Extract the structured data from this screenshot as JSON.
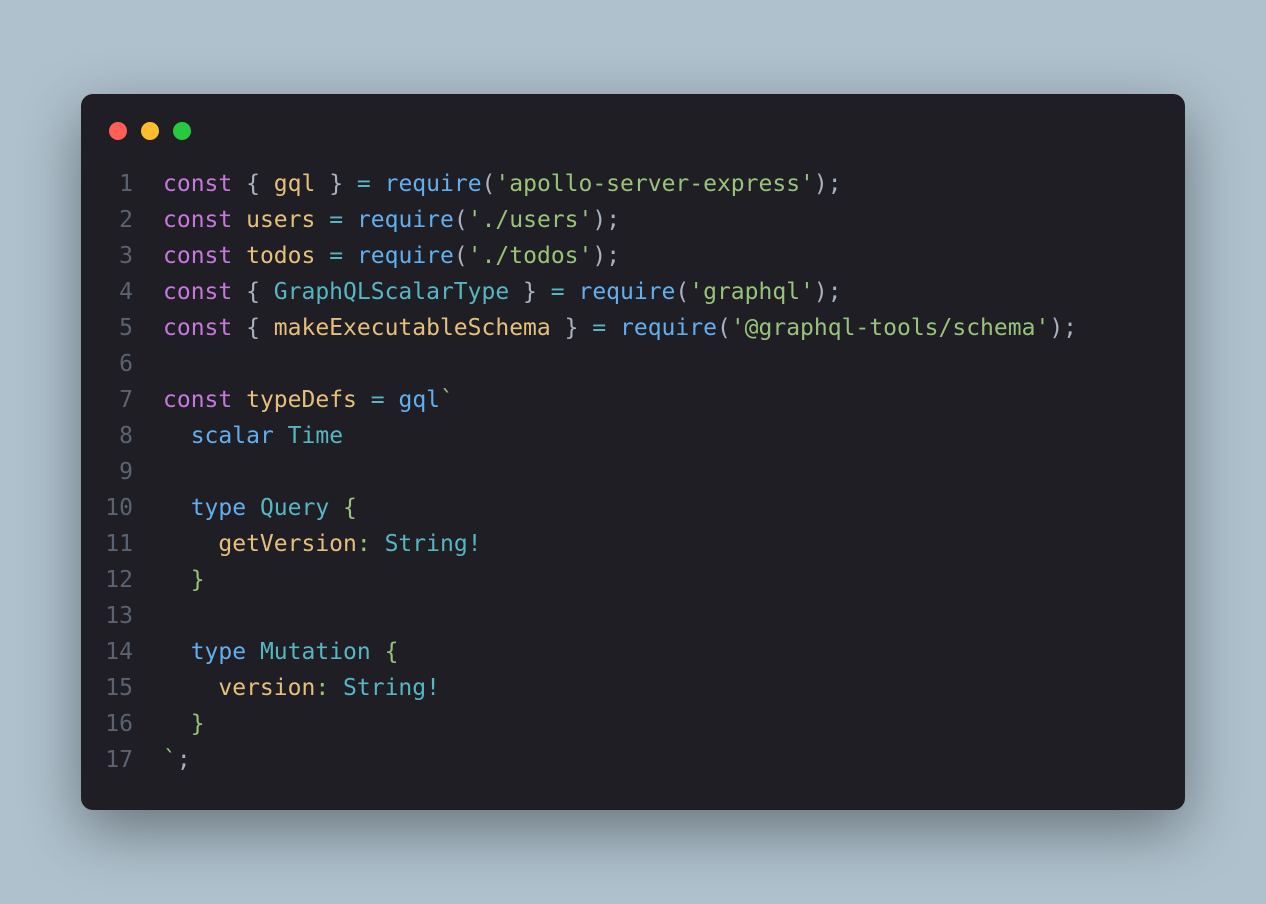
{
  "colors": {
    "bg": "#afc1cd",
    "window": "#1f1e25",
    "red": "#ff5f56",
    "yellow": "#ffbd2e",
    "green": "#27c93f",
    "keyword": "#c678dd",
    "definition": "#e5c07b",
    "function": "#61afef",
    "string": "#98c379",
    "identifier": "#56b6c2",
    "punct": "#abb2bf",
    "gutter": "#5c6370"
  },
  "lines": [
    {
      "n": "1",
      "t": [
        [
          "kw",
          "const"
        ],
        [
          "punct",
          " { "
        ],
        [
          "def",
          "gql"
        ],
        [
          "punct",
          " } "
        ],
        [
          "op",
          "="
        ],
        [
          "punct",
          " "
        ],
        [
          "fn",
          "require"
        ],
        [
          "punct",
          "("
        ],
        [
          "str",
          "'apollo-server-express'"
        ],
        [
          "punct",
          ");"
        ]
      ]
    },
    {
      "n": "2",
      "t": [
        [
          "kw",
          "const"
        ],
        [
          "punct",
          " "
        ],
        [
          "def",
          "users"
        ],
        [
          "punct",
          " "
        ],
        [
          "op",
          "="
        ],
        [
          "punct",
          " "
        ],
        [
          "fn",
          "require"
        ],
        [
          "punct",
          "("
        ],
        [
          "str",
          "'./users'"
        ],
        [
          "punct",
          ");"
        ]
      ]
    },
    {
      "n": "3",
      "t": [
        [
          "kw",
          "const"
        ],
        [
          "punct",
          " "
        ],
        [
          "def",
          "todos"
        ],
        [
          "punct",
          " "
        ],
        [
          "op",
          "="
        ],
        [
          "punct",
          " "
        ],
        [
          "fn",
          "require"
        ],
        [
          "punct",
          "("
        ],
        [
          "str",
          "'./todos'"
        ],
        [
          "punct",
          ");"
        ]
      ]
    },
    {
      "n": "4",
      "t": [
        [
          "kw",
          "const"
        ],
        [
          "punct",
          " { "
        ],
        [
          "ident",
          "GraphQLScalarType"
        ],
        [
          "punct",
          " } "
        ],
        [
          "op",
          "="
        ],
        [
          "punct",
          " "
        ],
        [
          "fn",
          "require"
        ],
        [
          "punct",
          "("
        ],
        [
          "str",
          "'graphql'"
        ],
        [
          "punct",
          ");"
        ]
      ]
    },
    {
      "n": "5",
      "t": [
        [
          "kw",
          "const"
        ],
        [
          "punct",
          " { "
        ],
        [
          "def",
          "makeExecutableSchema"
        ],
        [
          "punct",
          " } "
        ],
        [
          "op",
          "="
        ],
        [
          "punct",
          " "
        ],
        [
          "fn",
          "require"
        ],
        [
          "punct",
          "("
        ],
        [
          "str",
          "'@graphql-tools/schema'"
        ],
        [
          "punct",
          ");"
        ]
      ]
    },
    {
      "n": "6",
      "t": []
    },
    {
      "n": "7",
      "t": [
        [
          "kw",
          "const"
        ],
        [
          "punct",
          " "
        ],
        [
          "def",
          "typeDefs"
        ],
        [
          "punct",
          " "
        ],
        [
          "op",
          "="
        ],
        [
          "punct",
          " "
        ],
        [
          "fn",
          "gql"
        ],
        [
          "tmpl",
          "`"
        ]
      ]
    },
    {
      "n": "8",
      "t": [
        [
          "tmpl",
          "  "
        ],
        [
          "typekw",
          "scalar"
        ],
        [
          "tmpl",
          " "
        ],
        [
          "ident",
          "Time"
        ]
      ]
    },
    {
      "n": "9",
      "t": []
    },
    {
      "n": "10",
      "t": [
        [
          "tmpl",
          "  "
        ],
        [
          "typekw",
          "type"
        ],
        [
          "tmpl",
          " "
        ],
        [
          "ident",
          "Query"
        ],
        [
          "tmpl",
          " {"
        ]
      ]
    },
    {
      "n": "11",
      "t": [
        [
          "tmpl",
          "    "
        ],
        [
          "def",
          "getVersion"
        ],
        [
          "tmpl",
          ": "
        ],
        [
          "ident",
          "String"
        ],
        [
          "op",
          "!"
        ]
      ]
    },
    {
      "n": "12",
      "t": [
        [
          "tmpl",
          "  }"
        ]
      ]
    },
    {
      "n": "13",
      "t": []
    },
    {
      "n": "14",
      "t": [
        [
          "tmpl",
          "  "
        ],
        [
          "typekw",
          "type"
        ],
        [
          "tmpl",
          " "
        ],
        [
          "ident",
          "Mutation"
        ],
        [
          "tmpl",
          " {"
        ]
      ]
    },
    {
      "n": "15",
      "t": [
        [
          "tmpl",
          "    "
        ],
        [
          "def",
          "version"
        ],
        [
          "tmpl",
          ": "
        ],
        [
          "ident",
          "String"
        ],
        [
          "op",
          "!"
        ]
      ]
    },
    {
      "n": "16",
      "t": [
        [
          "tmpl",
          "  }"
        ]
      ]
    },
    {
      "n": "17",
      "t": [
        [
          "tmpl",
          "`"
        ],
        [
          "punct",
          ";"
        ]
      ]
    }
  ]
}
